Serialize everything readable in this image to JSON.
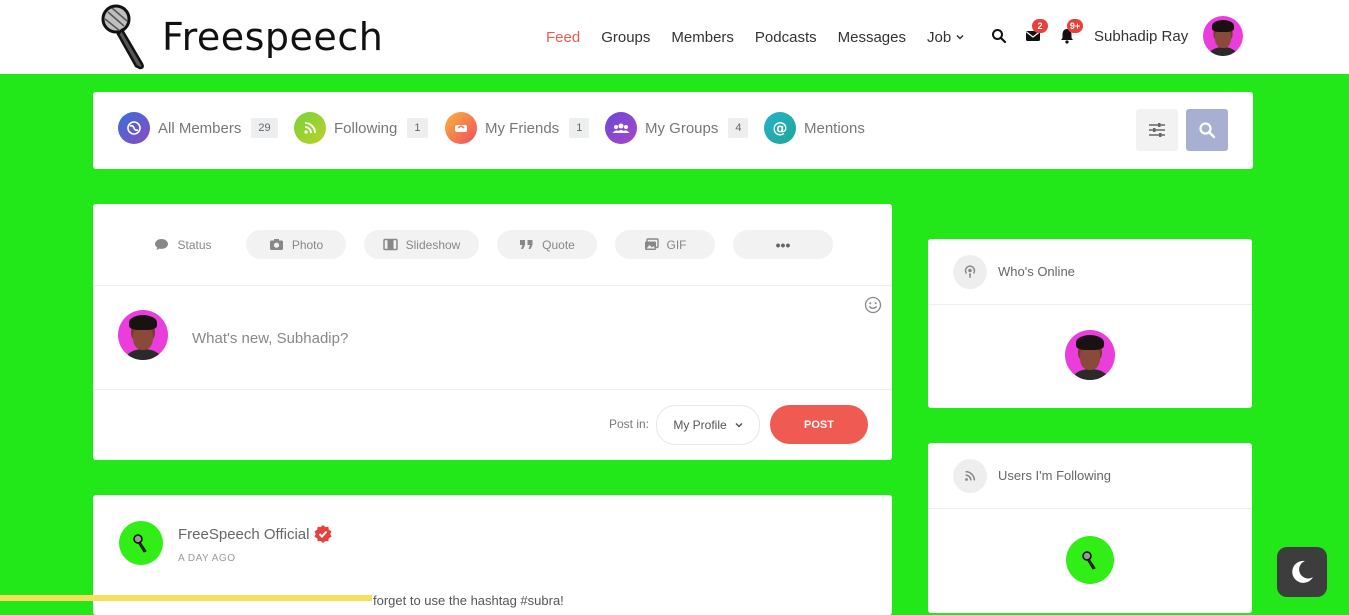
{
  "header": {
    "logo_text": "Freespeech",
    "nav": [
      {
        "label": "Feed",
        "active": true
      },
      {
        "label": "Groups"
      },
      {
        "label": "Members"
      },
      {
        "label": "Podcasts"
      },
      {
        "label": "Messages"
      },
      {
        "label": "Job",
        "dropdown": true
      }
    ],
    "messages_badge": "2",
    "notifications_badge": "9+",
    "user_name": "Subhadip Ray"
  },
  "filters": [
    {
      "label": "All Members",
      "count": "29",
      "icon": "globe-icon"
    },
    {
      "label": "Following",
      "count": "1",
      "icon": "rss-icon"
    },
    {
      "label": "My Friends",
      "count": "1",
      "icon": "handshake-icon"
    },
    {
      "label": "My Groups",
      "count": "4",
      "icon": "group-icon"
    },
    {
      "label": "Mentions",
      "icon": "at-icon"
    }
  ],
  "composer": {
    "tabs": [
      "Status",
      "Photo",
      "Slideshow",
      "Quote",
      "GIF",
      "•••"
    ],
    "placeholder": "What's new, Subhadip?",
    "post_in_label": "Post in:",
    "post_in_value": "My Profile",
    "post_button": "POST"
  },
  "post": {
    "author": "FreeSpeech Official",
    "time": "A DAY AGO",
    "text_fragment": "forget to use the hashtag #subra!"
  },
  "widgets": {
    "whos_online": "Who's Online",
    "following": "Users I'm Following"
  },
  "colors": {
    "page_bg": "#22e81a",
    "accent": "#ef5a52",
    "search_btn": "#a7b0d1"
  }
}
